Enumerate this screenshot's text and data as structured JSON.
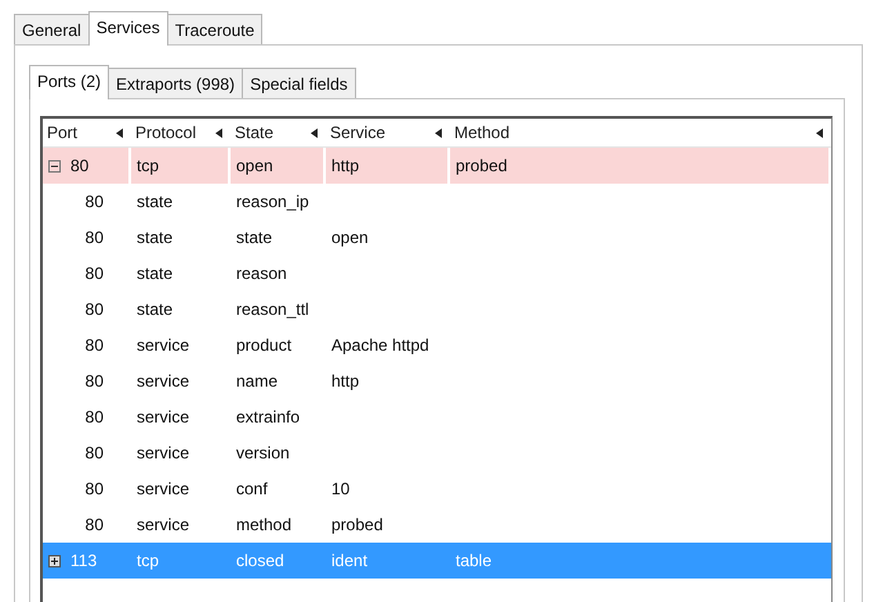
{
  "tabs": [
    {
      "label": "General",
      "selected": false
    },
    {
      "label": "Services",
      "selected": true
    },
    {
      "label": "Traceroute",
      "selected": false
    }
  ],
  "subtabs": [
    {
      "label": "Ports (2)",
      "selected": true
    },
    {
      "label": "Extraports (998)",
      "selected": false
    },
    {
      "label": "Special fields",
      "selected": false
    }
  ],
  "table": {
    "columns": [
      "Port",
      "Protocol",
      "State",
      "Service",
      "Method"
    ],
    "rows": [
      {
        "kind": "port",
        "expanded": true,
        "selected": false,
        "highlighted": true,
        "cells": [
          "80",
          "tcp",
          "open",
          "http",
          "probed"
        ]
      },
      {
        "kind": "detail",
        "cells": [
          "80",
          "state",
          "reason_ip"
        ]
      },
      {
        "kind": "detail",
        "cells": [
          "80",
          "state",
          "state",
          "open"
        ]
      },
      {
        "kind": "detail",
        "cells": [
          "80",
          "state",
          "reason"
        ]
      },
      {
        "kind": "detail",
        "cells": [
          "80",
          "state",
          "reason_ttl"
        ]
      },
      {
        "kind": "detail",
        "cells": [
          "80",
          "service",
          "product",
          "Apache httpd"
        ]
      },
      {
        "kind": "detail",
        "cells": [
          "80",
          "service",
          "name",
          "http"
        ]
      },
      {
        "kind": "detail",
        "cells": [
          "80",
          "service",
          "extrainfo"
        ]
      },
      {
        "kind": "detail",
        "cells": [
          "80",
          "service",
          "version"
        ]
      },
      {
        "kind": "detail",
        "cells": [
          "80",
          "service",
          "conf",
          "10"
        ]
      },
      {
        "kind": "detail",
        "cells": [
          "80",
          "service",
          "method",
          "probed"
        ]
      },
      {
        "kind": "port",
        "expanded": false,
        "selected": true,
        "highlighted": false,
        "cells": [
          "113",
          "tcp",
          "closed",
          "ident",
          "table"
        ]
      }
    ]
  }
}
